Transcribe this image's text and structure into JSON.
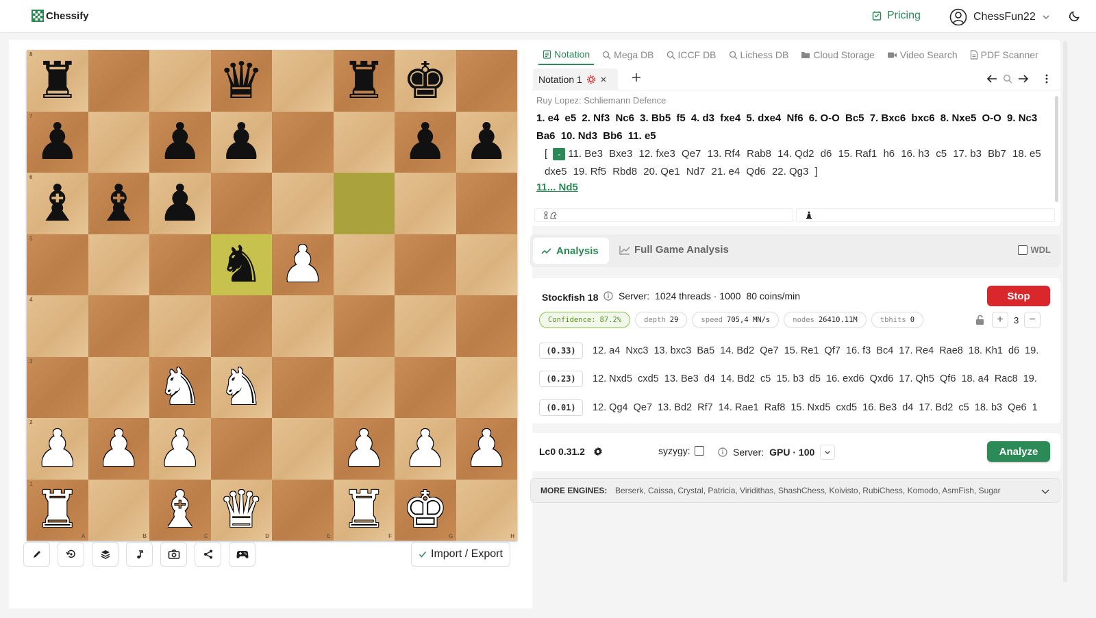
{
  "header": {
    "logo_text": "Chessify",
    "pricing_label": "Pricing",
    "username": "ChessFun22",
    "accent": "#2c8a57"
  },
  "board": {
    "ranks": [
      "8",
      "7",
      "6",
      "5",
      "4",
      "3",
      "2",
      "1"
    ],
    "files": [
      "A",
      "B",
      "C",
      "D",
      "E",
      "F",
      "G",
      "H"
    ],
    "rows": [
      [
        "br",
        "",
        "",
        "bq",
        "",
        "br",
        "bk",
        ""
      ],
      [
        "bp",
        "",
        "bp",
        "bp",
        "",
        "",
        "bp",
        "bp"
      ],
      [
        "bb",
        "bb",
        "bp",
        "",
        "",
        "",
        "",
        ""
      ],
      [
        "",
        "",
        "",
        "bn",
        "wp",
        "",
        "",
        ""
      ],
      [
        "",
        "",
        "",
        "",
        "",
        "",
        "",
        ""
      ],
      [
        "",
        "",
        "wn",
        "wn",
        "",
        "",
        "",
        ""
      ],
      [
        "wp",
        "wp",
        "wp",
        "",
        "",
        "wp",
        "wp",
        "wp"
      ],
      [
        "wr",
        "",
        "wb",
        "wq",
        "",
        "wr",
        "wk",
        ""
      ]
    ],
    "highlights": [
      "f6",
      "d5"
    ]
  },
  "toolbar": {
    "buttons": [
      "pencil-icon",
      "flip-board-icon",
      "layers-icon",
      "music-icon",
      "camera-icon",
      "share-icon",
      "gamepad-icon"
    ],
    "import_export_label": "Import / Export"
  },
  "notation": {
    "tabs": [
      {
        "label": "Notation",
        "icon": "notation-icon",
        "active": true
      },
      {
        "label": "Mega DB",
        "icon": "search-icon"
      },
      {
        "label": "ICCF DB",
        "icon": "search-icon"
      },
      {
        "label": "Lichess DB",
        "icon": "search-icon"
      },
      {
        "label": "Cloud Storage",
        "icon": "folder-icon"
      },
      {
        "label": "Video Search",
        "icon": "video-icon"
      },
      {
        "label": "PDF Scanner",
        "icon": "pdf-icon"
      }
    ],
    "notebook_tab": "Notation 1",
    "opening_name": "Ruy Lopez: Schliemann Defence",
    "main_moves": [
      "1. e4",
      "e5",
      "2. Nf3",
      "Nc6",
      "3. Bb5",
      "f5",
      "4. d3",
      "fxe4",
      "5. dxe4",
      "Nf6",
      "6. O-O",
      "Bc5",
      "7. Bxc6",
      "bxc6",
      "8. Nxe5",
      "O-O",
      "9. Nc3",
      "Ba6",
      "10. Nd3",
      "Bb6",
      "11. e5"
    ],
    "variation_toggle": "-",
    "variation_moves": [
      "11. Be3",
      "Bxe3",
      "12. fxe3",
      "Qe7",
      "13. Rf4",
      "Rab8",
      "14. Qd2",
      "d6",
      "15. Raf1",
      "h6",
      "16. h3",
      "c5",
      "17. b3",
      "Bb7",
      "18. e5",
      "dxe5",
      "19. Rf5",
      "Rbd8",
      "20. Qe1",
      "Nd7",
      "21. e4",
      "Qd6",
      "22. Qg3"
    ],
    "current_move": "11... Nd5"
  },
  "analysis": {
    "tab_label": "Analysis",
    "full_game_label": "Full Game Analysis",
    "wdl_label": "WDL"
  },
  "stockfish": {
    "name": "Stockfish 18",
    "server_label": "Server:",
    "server_value": "1024 threads · 1000",
    "server_cost": "80 coins/min",
    "stop_label": "Stop",
    "stats": [
      {
        "key": "Confidence:",
        "value": "87.2%"
      },
      {
        "key": "depth",
        "value": "29"
      },
      {
        "key": "speed",
        "value": "705,4 MN/s"
      },
      {
        "key": "nodes",
        "value": "26410.11M"
      },
      {
        "key": "tbhits",
        "value": "0"
      }
    ],
    "lines_count": "3",
    "lines": [
      {
        "eval": "(0.33)",
        "moves": "12. a4  Nxc3  13. bxc3  Ba5  14. Bd2  Qe7  15. Re1  Qf7  16. f3  Bc4  17. Re4  Rae8  18. Kh1  d6  19."
      },
      {
        "eval": "(0.23)",
        "moves": "12. Nxd5  cxd5  13. Be3  d4  14. Bd2  c5  15. b3  d5  16. exd6  Qxd6  17. Qh5  Qf6  18. a4  Rac8  19."
      },
      {
        "eval": "(0.01)",
        "moves": "12. Qg4  Qe7  13. Bd2  Rf7  14. Rae1  Raf8  15. Nxd5  cxd5  16. Be3  d4  17. Bd2  c5  18. b3  Qe6  1"
      }
    ]
  },
  "lc0": {
    "name": "Lc0 0.31.2",
    "syzygy_label": "syzygy:",
    "server_label": "Server:",
    "server_value": "GPU · 100",
    "analyze_label": "Analyze"
  },
  "more_engines": {
    "label": "MORE ENGINES:",
    "list": "Berserk, Caissa, Crystal, Patricia, Viridithas, ShashChess, Koivisto, RubiChess, Komodo, AsmFish, Sugar"
  }
}
